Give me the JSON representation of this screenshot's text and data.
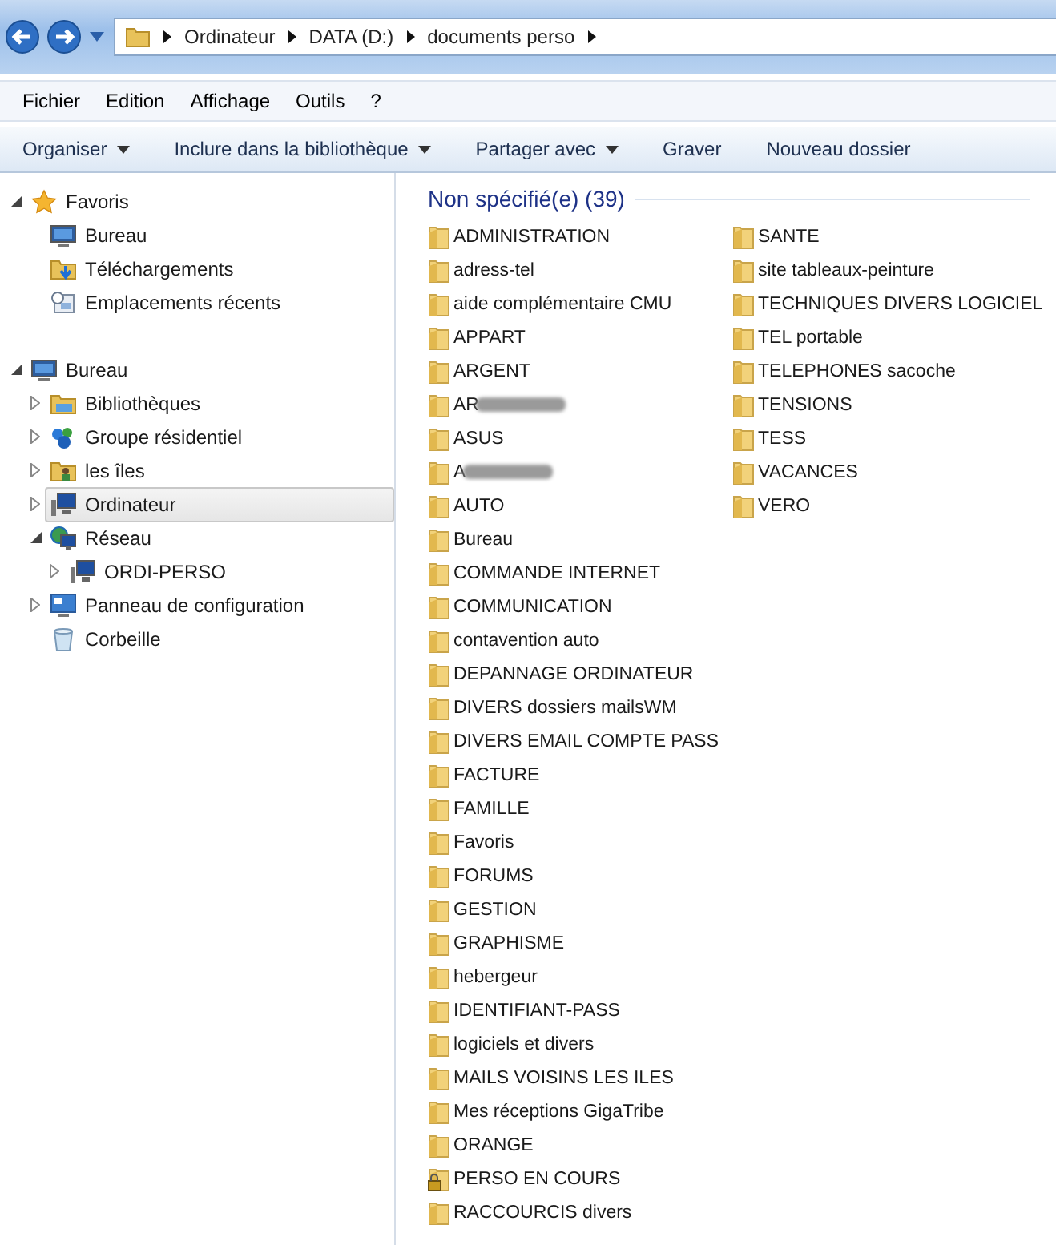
{
  "address_bar": {
    "segments": [
      "Ordinateur",
      "DATA (D:)",
      "documents perso"
    ]
  },
  "menu_bar": [
    "Fichier",
    "Edition",
    "Affichage",
    "Outils",
    "?"
  ],
  "toolbar": [
    {
      "label": "Organiser",
      "dropdown": true
    },
    {
      "label": "Inclure dans la bibliothèque",
      "dropdown": true
    },
    {
      "label": "Partager avec",
      "dropdown": true
    },
    {
      "label": "Graver",
      "dropdown": false
    },
    {
      "label": "Nouveau dossier",
      "dropdown": false
    }
  ],
  "navigation": [
    {
      "label": "Favoris",
      "kind": "star",
      "expanded": true,
      "selected": false,
      "children": [
        {
          "label": "Bureau",
          "kind": "desktop",
          "selected": false
        },
        {
          "label": "Téléchargements",
          "kind": "download",
          "selected": false
        },
        {
          "label": "Emplacements récents",
          "kind": "recent",
          "selected": false
        }
      ]
    },
    {
      "label": "Bureau",
      "kind": "desktop",
      "expanded": true,
      "selected": false,
      "children": [
        {
          "label": "Bibliothèques",
          "kind": "library",
          "expanded": false,
          "selected": false
        },
        {
          "label": "Groupe résidentiel",
          "kind": "homegroup",
          "expanded": false,
          "selected": false
        },
        {
          "label": "les îles",
          "kind": "user",
          "expanded": false,
          "selected": false
        },
        {
          "label": "Ordinateur",
          "kind": "computer",
          "expanded": false,
          "selected": true
        },
        {
          "label": "Réseau",
          "kind": "network",
          "expanded": true,
          "selected": false,
          "children": [
            {
              "label": "ORDI-PERSO",
              "kind": "computer",
              "expanded": false,
              "selected": false
            }
          ]
        },
        {
          "label": "Panneau de configuration",
          "kind": "control",
          "expanded": false,
          "selected": false
        },
        {
          "label": "Corbeille",
          "kind": "recycle",
          "selected": false
        }
      ]
    }
  ],
  "group_header": "Non spécifié(e) (39)",
  "folders": [
    {
      "name": "ADMINISTRATION",
      "kind": "folder"
    },
    {
      "name": "adress-tel",
      "kind": "folder"
    },
    {
      "name": "aide complémentaire CMU",
      "kind": "folder"
    },
    {
      "name": "APPART",
      "kind": "folder"
    },
    {
      "name": "ARGENT",
      "kind": "folder"
    },
    {
      "name": "AR",
      "kind": "redacted"
    },
    {
      "name": "ASUS",
      "kind": "folder"
    },
    {
      "name": "A",
      "kind": "redacted"
    },
    {
      "name": "AUTO",
      "kind": "folder"
    },
    {
      "name": "Bureau",
      "kind": "folder"
    },
    {
      "name": "COMMANDE INTERNET",
      "kind": "folder"
    },
    {
      "name": "COMMUNICATION",
      "kind": "folder"
    },
    {
      "name": "contavention auto",
      "kind": "folder"
    },
    {
      "name": "DEPANNAGE ORDINATEUR",
      "kind": "folder"
    },
    {
      "name": "DIVERS dossiers mailsWM",
      "kind": "folder"
    },
    {
      "name": "DIVERS EMAIL COMPTE PASS",
      "kind": "folder"
    },
    {
      "name": "FACTURE",
      "kind": "folder"
    },
    {
      "name": "FAMILLE",
      "kind": "folder"
    },
    {
      "name": "Favoris",
      "kind": "folder"
    },
    {
      "name": "FORUMS",
      "kind": "folder"
    },
    {
      "name": "GESTION",
      "kind": "folder"
    },
    {
      "name": "GRAPHISME",
      "kind": "folder"
    },
    {
      "name": "hebergeur",
      "kind": "folder"
    },
    {
      "name": "IDENTIFIANT-PASS",
      "kind": "folder"
    },
    {
      "name": "logiciels et divers",
      "kind": "folder"
    },
    {
      "name": "MAILS VOISINS LES ILES",
      "kind": "folder"
    },
    {
      "name": "Mes réceptions GigaTribe",
      "kind": "folder"
    },
    {
      "name": "ORANGE",
      "kind": "folder"
    },
    {
      "name": "PERSO EN COURS",
      "kind": "locked"
    },
    {
      "name": "RACCOURCIS divers",
      "kind": "folder"
    },
    {
      "name": "SANTE",
      "kind": "folder"
    },
    {
      "name": "site tableaux-peinture",
      "kind": "folder"
    },
    {
      "name": "TECHNIQUES DIVERS LOGICIEL",
      "kind": "folder"
    },
    {
      "name": "TEL portable",
      "kind": "folder"
    },
    {
      "name": "TELEPHONES sacoche",
      "kind": "folder"
    },
    {
      "name": "TENSIONS",
      "kind": "folder"
    },
    {
      "name": "TESS",
      "kind": "folder"
    },
    {
      "name": "VACANCES",
      "kind": "folder"
    },
    {
      "name": "VERO",
      "kind": "folder"
    }
  ]
}
